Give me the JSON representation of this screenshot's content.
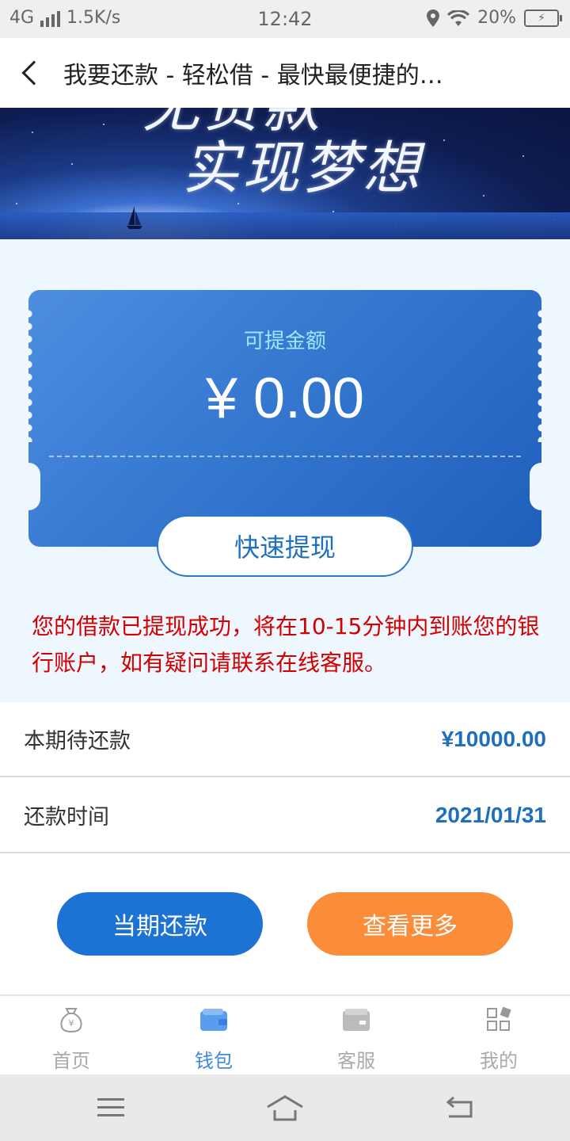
{
  "status_bar": {
    "network": "4G",
    "speed": "1.5K/s",
    "time": "12:42",
    "battery": "20%"
  },
  "header": {
    "title": "我要还款 - 轻松借 - 最快最便捷的…"
  },
  "banner": {
    "line1": "无贷款",
    "line2": "实现梦想"
  },
  "card": {
    "label": "可提金额",
    "amount": "¥ 0.00",
    "withdraw_button": "快速提现"
  },
  "notice": "您的借款已提现成功，将在10-15分钟内到账您的银行账户，如有疑问请联系在线客服。",
  "info": {
    "due_label": "本期待还款",
    "due_value": "¥10000.00",
    "date_label": "还款时间",
    "date_value": "2021/01/31"
  },
  "actions": {
    "repay": "当期还款",
    "more": "查看更多"
  },
  "tabs": [
    {
      "label": "首页",
      "icon": "money-bag-icon"
    },
    {
      "label": "钱包",
      "icon": "wallet-icon"
    },
    {
      "label": "客服",
      "icon": "service-icon"
    },
    {
      "label": "我的",
      "icon": "profile-grid-icon"
    }
  ],
  "colors": {
    "primary": "#1c73d3",
    "accent": "#fb8c3a",
    "notice": "#d40000"
  }
}
